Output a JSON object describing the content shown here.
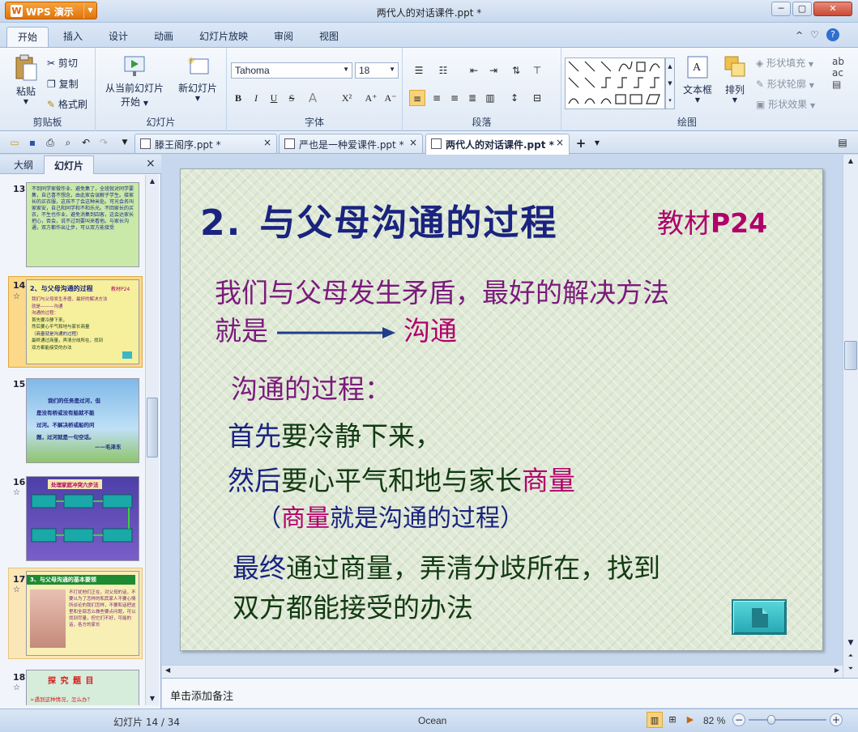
{
  "app": {
    "button_label": "WPS 演示",
    "logo_letter": "W",
    "doc_title": "两代人的对话课件.ppt *"
  },
  "window_controls": {
    "minimize": "─",
    "restore": "▢",
    "close": "✕"
  },
  "menu": {
    "tabs": [
      "开始",
      "插入",
      "设计",
      "动画",
      "幻灯片放映",
      "审阅",
      "视图"
    ],
    "help_icons": [
      "^",
      "♡",
      "?"
    ]
  },
  "ribbon": {
    "clipboard": {
      "paste": "粘贴",
      "cut": "剪切",
      "copy": "复制",
      "format_painter": "格式刷",
      "label": "剪贴板"
    },
    "slides": {
      "from_current": "从当前幻灯片",
      "start": "开始",
      "new_slide": "新幻灯片",
      "label": "幻灯片"
    },
    "font": {
      "font_name": "Tahoma",
      "font_size": "18",
      "bold": "B",
      "italic": "I",
      "underline": "U",
      "strike": "S",
      "color": "A",
      "superscript": "X²",
      "grow": "A⁺",
      "shrink": "A⁻",
      "label": "字体"
    },
    "paragraph": {
      "label": "段落"
    },
    "drawing": {
      "textbox": "文本框",
      "arrange": "排列",
      "shape_fill": "形状填充",
      "shape_outline": "形状轮廓",
      "shape_effect": "形状效果",
      "label": "绘图"
    }
  },
  "doc_tabs": [
    {
      "title": "滕王阁序.ppt *",
      "close": "×"
    },
    {
      "title": "严也是一种爱课件.ppt *",
      "close": "×"
    },
    {
      "title": "两代人的对话课件.ppt *",
      "close": "×"
    }
  ],
  "left_pane": {
    "tabs": [
      "大纲",
      "幻灯片"
    ],
    "close": "×",
    "thumbs": [
      {
        "num": "13",
        "text": "不到同学家做作业、避免集了，全班就对同学要集，自己喜不想念，由此家会误解子学生。接家长的买衣服，这孩不了会这种米处。可光会名叫家家安，自己和同学和不和乐光。不回家长的买衣，不生也作业，避免消集到四客，这会达家长把心，否会，说不过到要叫来看他。与家长沟通，双方都作出让步，可以双方能接受"
      },
      {
        "num": "14",
        "title": "2、与父母沟通的过程",
        "tag": "教材P24",
        "lines": [
          "我们与父母发生矛盾，最好的解决方法",
          "就是———沟通",
          "沟通的过程：",
          "首先要冷静下来，",
          "然后要心平气和地与家长商量",
          "（商量就是沟通的过程）",
          "最终通过商量，弄清分歧所在，找到",
          "双方都能接受的办法"
        ]
      },
      {
        "num": "15",
        "lines": [
          "我们的任务是过河，但",
          "是没有桥或没有船就不能",
          "过河。不解决桥或船的问",
          "题，过河就是一句空话。",
          "——毛泽东"
        ]
      },
      {
        "num": "16",
        "title": "处理家庭冲突六步法"
      },
      {
        "num": "17",
        "title": "3、与父母沟通的基本要领",
        "text": "不打扰他们正在，对父母的话，不要以为了怎样的和其家人不要心情所谈论的我们怎样，不要和话把这里和全部怎么做些要点问题，可以找到尽量，但它们不好，可能的话，各方的家长"
      },
      {
        "num": "18",
        "title": "探 究 题 目",
        "text": "➢遇到这种情况，怎么办？"
      }
    ]
  },
  "slide": {
    "heading_num": "2.",
    "heading": "与父母沟通的过程",
    "ref_prefix": "教材",
    "ref_page": "P24",
    "line1": "我们与父母发生矛盾，最好的解决方法",
    "line2_a": "就是",
    "line2_b": "沟通",
    "line3": "沟通的过程：",
    "line4_a": "首先",
    "line4_b": "要冷静下来，",
    "line5_a": "然后",
    "line5_b": "要心平气和地与家长",
    "line5_c": "商量",
    "line6_a": "（",
    "line6_b": "商量",
    "line6_c": "就是沟通的过程）",
    "line7_a": "最终",
    "line7_b": "通过商量，弄清分歧所在，找到",
    "line8": "双方都能接受的办法"
  },
  "notes": {
    "placeholder": "单击添加备注"
  },
  "status": {
    "slide_info": "幻灯片 14 / 34",
    "theme": "Ocean",
    "zoom": "82 %",
    "zoom_level": 0.82
  },
  "colors": {
    "accent": "#1f3d8a",
    "title_blue": "#1a237e",
    "magenta": "#b0006a",
    "purple": "#7b1a7b",
    "green_dark": "#123a12"
  }
}
